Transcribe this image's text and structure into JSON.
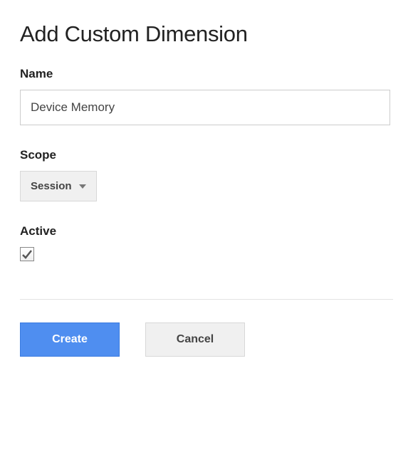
{
  "title": "Add Custom Dimension",
  "fields": {
    "name": {
      "label": "Name",
      "value": "Device Memory"
    },
    "scope": {
      "label": "Scope",
      "selected": "Session"
    },
    "active": {
      "label": "Active",
      "checked": true
    }
  },
  "buttons": {
    "create": "Create",
    "cancel": "Cancel"
  }
}
